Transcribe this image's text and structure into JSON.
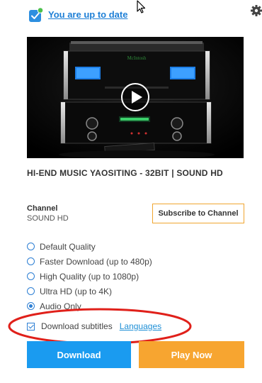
{
  "header": {
    "status_text": "You are up to date",
    "status_icon": "update-check-icon",
    "settings_icon": "gear-icon"
  },
  "video": {
    "thumbnail": "amplifier-thumbnail",
    "play_icon": "play-icon",
    "title": "HI-END MUSIC YAOSITING - 32BIT | SOUND HD"
  },
  "channel": {
    "label": "Channel",
    "name": "SOUND HD",
    "subscribe_label": "Subscribe to Channel"
  },
  "quality_options": [
    {
      "label": "Default Quality",
      "selected": false
    },
    {
      "label": "Faster Download (up to 480p)",
      "selected": false
    },
    {
      "label": "High Quality (up to 1080p)",
      "selected": false
    },
    {
      "label": "Ultra HD (up to 4K)",
      "selected": false
    },
    {
      "label": "Audio Only",
      "selected": true
    }
  ],
  "subtitles": {
    "label": "Download subtitles",
    "checked": true,
    "languages_link": "Languages"
  },
  "actions": {
    "download_label": "Download",
    "play_now_label": "Play Now"
  },
  "colors": {
    "link_blue": "#1e7fd6",
    "download_blue": "#1a9bf0",
    "play_orange": "#f7a530",
    "subscribe_border": "#f0a530",
    "annotation_red": "#e0201a"
  }
}
